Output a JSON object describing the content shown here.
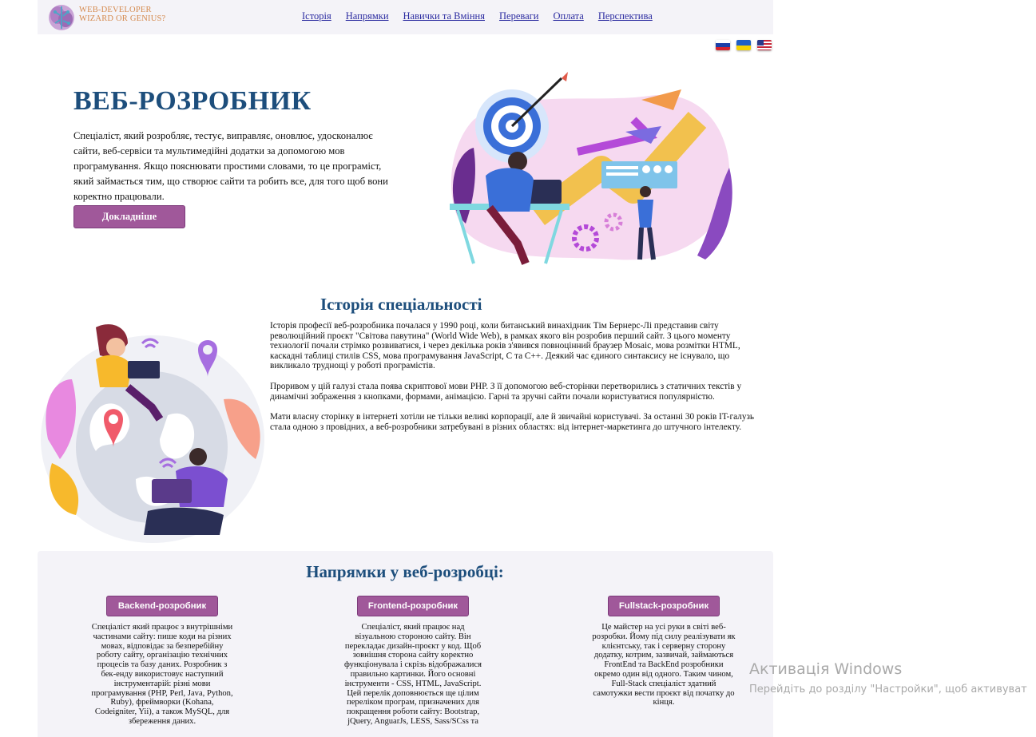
{
  "header": {
    "logo_line1": "WEB-DEVELOPER",
    "logo_line2": "WIZARD OR GENIUS?",
    "nav": [
      "Історія",
      "Напрямки",
      "Навички та Вміння",
      "Переваги",
      "Оплата",
      "Перспектива"
    ]
  },
  "languages": [
    "ru",
    "ua",
    "us"
  ],
  "hero": {
    "title": "ВЕБ-РОЗРОБНИК",
    "description": "Спеціаліст, який розробляє, тестує, виправляє, оновлює, удосконалює сайти, веб-сервіси та мультимедійні додатки за допомогою мов програмування. Якщо пояснювати простими словами, то це програміст, який займається тим, що створює сайти та робить все, для того щоб вони коректно працювали.",
    "button": "Докладніше"
  },
  "history": {
    "title": "Історія спеціальності",
    "paragraphs": [
      "Історія професії веб-розробника почалася у 1990 році, коли битанський винахідник Тім Бернерс-Лі представив світу революційний проєкт \"Світова павутина\" (World Wide Web), в рамках якого він розробив перший сайт. З цього моменту технології почали стрімко розвиватися, і через декілька років з'явився повноцінний браузер Mosaic, мова розмітки HTML, каскадні таблиці стилів CSS, мова програмування JavaScript, C та C++. Деякий час єдиного синтаксису не існувало, що викликало труднощі у роботі програмістів.",
      "Проривом у цій галузі стала поява скриптової мови PHP. З її допомогою веб-сторінки перетворились з статичних текстів у динамічні зображення з кнопками, формами, анімацією. Гарні та зручні сайти почали користуватися популярністю.",
      "Мати власну сторінку в інтернеті хотіли не тільки великі корпорації, але й звичайні користувачі. За останні 30 років IT-галузь стала одною з провідних, а веб-розробники затребувані в різних областях: від інтернет-маркетинга до штучного інтелекту."
    ]
  },
  "directions": {
    "title": "Напрямки у веб-розробці:",
    "items": [
      {
        "button": "Backend-розробник",
        "text": "Спеціаліст який працює з внутрішніми частинами сайту: пише коди на різних мовах, відповідає за безперебійну роботу сайту, організацію технічних процесів та базу даних. Розробник з бек-енду використовує наступний інструментарій: різні мови програмування (PHP, Perl, Java, Python, Ruby), фреймворки (Kohana, Codeigniter, Yii), а також MySQL, для збереження даних."
      },
      {
        "button": "Frontend-розробник",
        "text": "Спеціаліст, який працює над візуальною стороною сайту. Він перекладає дизайн-проєкт у код. Щоб зовнішня сторона сайту коректно функціонувала і скрізь відображалися правильно картинки. Його основні інструменти - CSS, HTML, JavaScript. Цей перелік доповнюється ще цілим переліком програм, призначених для покращення роботи сайту: Bootstrap, jQuery, AnguarJs, LESS, Sass/SCss та"
      },
      {
        "button": "Fullstack-розробник",
        "text": "Це майстер на усі руки в світі веб-розробки. Йому під силу реалізувати як клієнтську, так і серверну сторону додатку, котрим, зазвичай, займаються FrontEnd та BackEnd розробники окремо один від одного. Таким чином, Full-Stack спеціаліст здатний самотужки вести проєкт від початку до кінця."
      }
    ]
  },
  "watermark": {
    "title": "Активація Windows",
    "subtitle": "Перейдіть до розділу \"Настройки\", щоб активуват"
  }
}
